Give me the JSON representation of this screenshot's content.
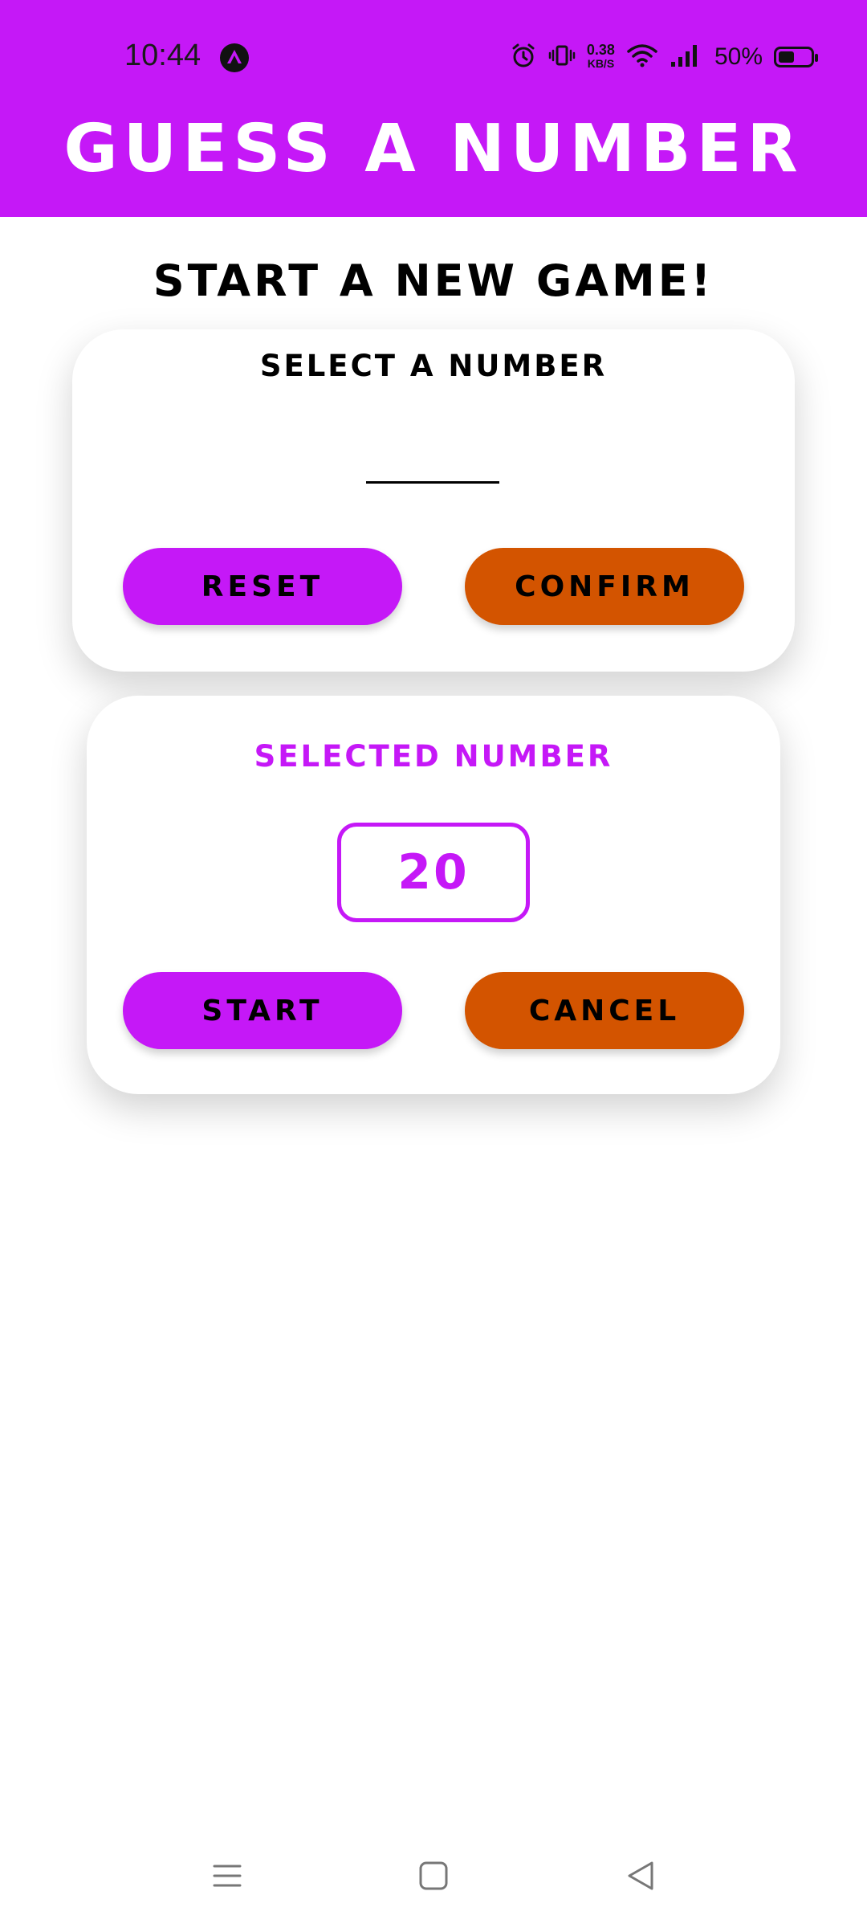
{
  "status_bar": {
    "time": "10:44",
    "net_speed_value": "0.38",
    "net_speed_unit": "KB/S",
    "battery": "50%",
    "battery_level": 0.5
  },
  "app": {
    "title": "GUESS A NUMBER",
    "accent_color": "#c518f7",
    "secondary_color": "#d35400"
  },
  "screen": {
    "heading": "START A NEW GAME!"
  },
  "input_card": {
    "title": "SELECT A NUMBER",
    "input_value": "",
    "reset_label": "RESET",
    "confirm_label": "CONFIRM"
  },
  "selected_card": {
    "title": "SELECTED NUMBER",
    "number": "20",
    "start_label": "START",
    "cancel_label": "CANCEL"
  },
  "nav": {
    "icons": [
      "menu-icon",
      "home-icon",
      "back-icon"
    ]
  }
}
